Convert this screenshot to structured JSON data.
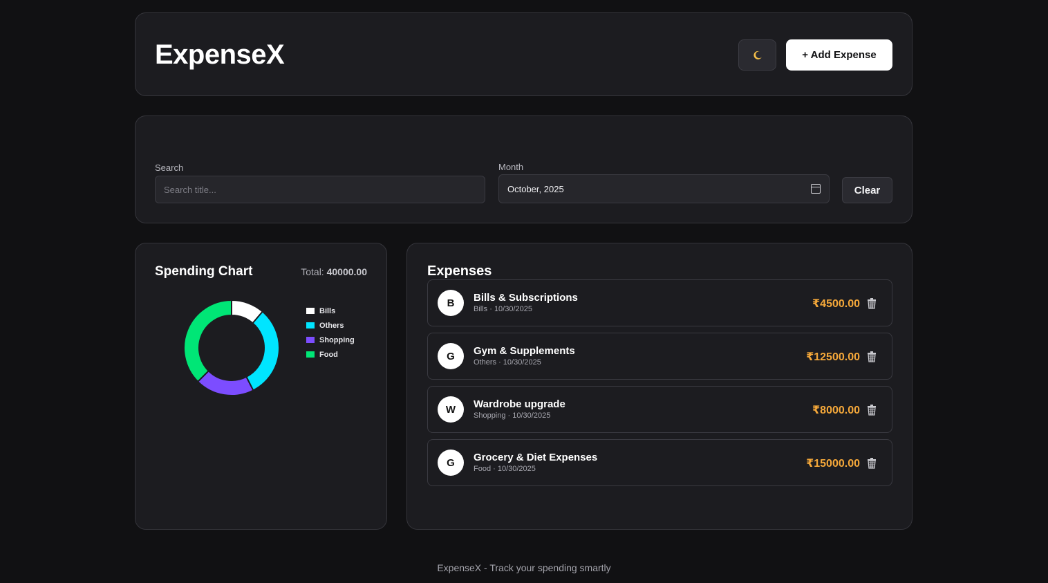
{
  "header": {
    "title": "ExpenseX",
    "theme_icon": "moon-icon",
    "add_label": "+ Add Expense"
  },
  "filters": {
    "search_label": "Search",
    "search_placeholder": "Search title...",
    "search_value": "",
    "month_label": "Month",
    "month_value": "October, 2025",
    "calendar_icon": "calendar-icon",
    "clear_label": "Clear"
  },
  "chart": {
    "title": "Spending Chart",
    "total_label": "Total:",
    "total_value": "40000.00"
  },
  "chart_data": {
    "type": "pie",
    "donut": true,
    "categories": [
      "Bills",
      "Others",
      "Shopping",
      "Food"
    ],
    "values": [
      4500,
      12500,
      8000,
      15000
    ],
    "colors": [
      "#ffffff",
      "#00e5ff",
      "#7c4dff",
      "#00e676"
    ],
    "legend_position": "right"
  },
  "expenses": {
    "title": "Expenses",
    "items": [
      {
        "initial": "B",
        "name": "Bills & Subscriptions",
        "meta": "Bills · 10/30/2025",
        "amount": "₹4500.00"
      },
      {
        "initial": "G",
        "name": "Gym & Supplements",
        "meta": "Others · 10/30/2025",
        "amount": "₹12500.00"
      },
      {
        "initial": "W",
        "name": "Wardrobe upgrade",
        "meta": "Shopping · 10/30/2025",
        "amount": "₹8000.00"
      },
      {
        "initial": "G",
        "name": "Grocery & Diet Expenses",
        "meta": "Food · 10/30/2025",
        "amount": "₹15000.00"
      }
    ],
    "delete_icon": "trash-icon"
  },
  "colors": {
    "background": "#111113",
    "card": "#1c1c20",
    "amount": "#f5a83a"
  },
  "footer": {
    "text": "ExpenseX - Track your spending smartly"
  }
}
